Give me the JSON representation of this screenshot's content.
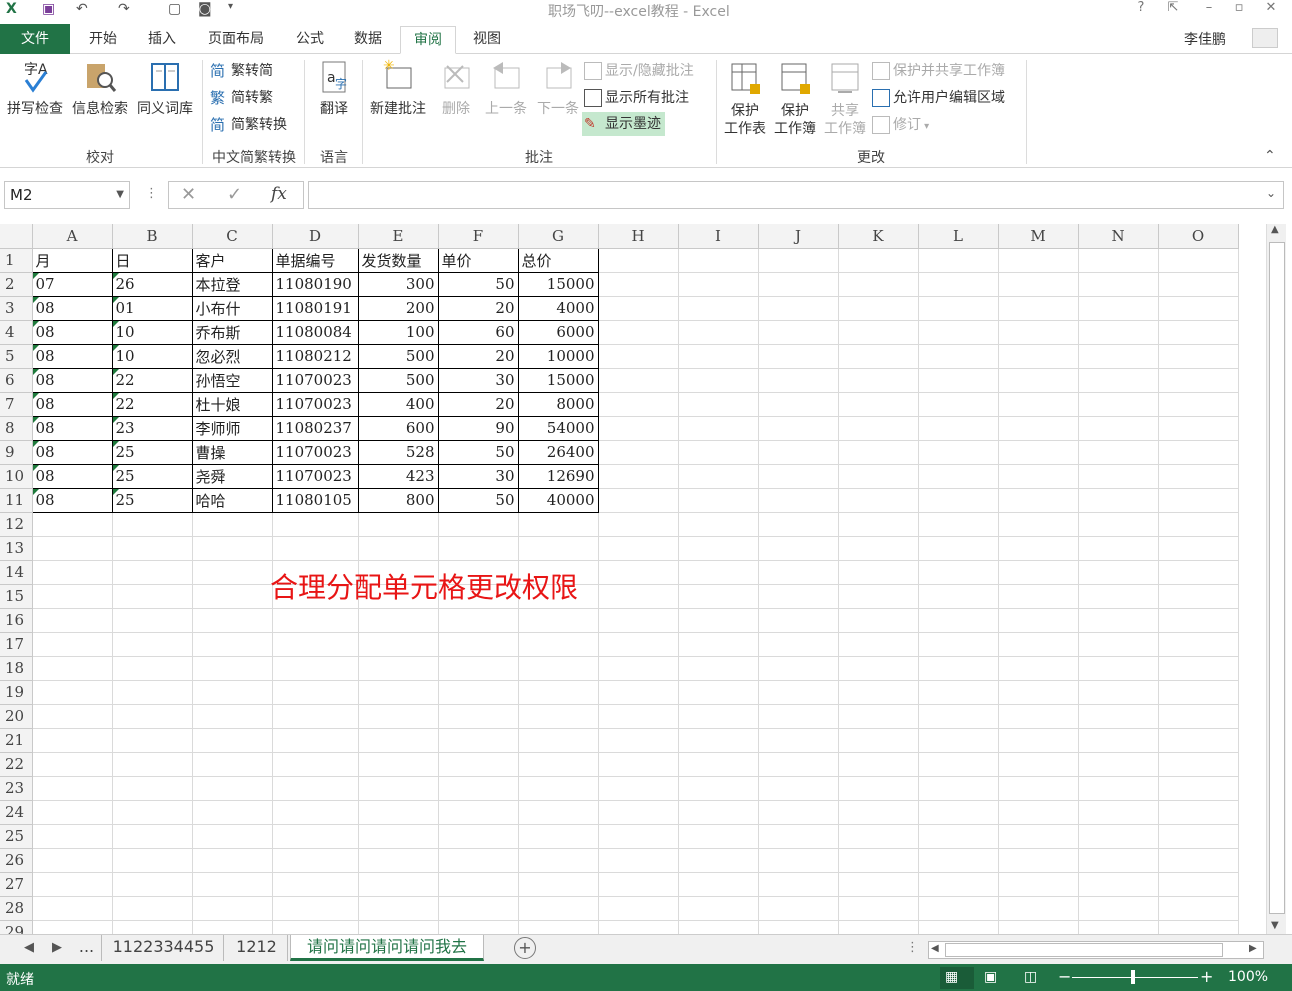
{
  "title_bar": {
    "app_title": "职场飞叨--excel教程 - Excel",
    "help": "?"
  },
  "tabs": {
    "file": "文件",
    "home": "开始",
    "insert": "插入",
    "layout": "页面布局",
    "formulas": "公式",
    "data": "数据",
    "review": "审阅",
    "view": "视图"
  },
  "user": {
    "name": "李佳鹏"
  },
  "ribbon": {
    "spell": "拼写检查",
    "research": "信息检索",
    "thesaurus": "同义词库",
    "proofing_group": "校对",
    "trad_to_simp": "繁转简",
    "simp_to_trad": "简转繁",
    "convert": "简繁转换",
    "chinese_group": "中文简繁转换",
    "translate": "翻译",
    "language_group": "语言",
    "new_comment": "新建批注",
    "delete": "删除",
    "prev": "上一条",
    "next": "下一条",
    "show_hide": "显示/隐藏批注",
    "show_all": "显示所有批注",
    "show_ink": "显示墨迹",
    "comments_group": "批注",
    "protect_sheet_1": "保护",
    "protect_sheet_2": "工作表",
    "protect_wb_1": "保护",
    "protect_wb_2": "工作簿",
    "share_1": "共享",
    "share_2": "工作簿",
    "protect_share": "保护并共享工作簿",
    "allow_edit": "允许用户编辑区域",
    "track": "修订",
    "changes_group": "更改"
  },
  "formula_bar": {
    "name_box": "M2",
    "formula": ""
  },
  "columns": [
    "A",
    "B",
    "C",
    "D",
    "E",
    "F",
    "G",
    "H",
    "I",
    "J",
    "K",
    "L",
    "M",
    "N",
    "O"
  ],
  "rows": [
    [
      "月",
      "日",
      "客户",
      "单据编号",
      "发货数量",
      "单价",
      "总价"
    ],
    [
      "07",
      "26",
      "本拉登",
      "11080190",
      "300",
      "50",
      "15000"
    ],
    [
      "08",
      "01",
      "小布什",
      "11080191",
      "200",
      "20",
      "4000"
    ],
    [
      "08",
      "10",
      "乔布斯",
      "11080084",
      "100",
      "60",
      "6000"
    ],
    [
      "08",
      "10",
      "忽必烈",
      "11080212",
      "500",
      "20",
      "10000"
    ],
    [
      "08",
      "22",
      "孙悟空",
      "11070023",
      "500",
      "30",
      "15000"
    ],
    [
      "08",
      "22",
      "杜十娘",
      "11070023",
      "400",
      "20",
      "8000"
    ],
    [
      "08",
      "23",
      "李师师",
      "11080237",
      "600",
      "90",
      "54000"
    ],
    [
      "08",
      "25",
      "曹操",
      "11070023",
      "528",
      "50",
      "26400"
    ],
    [
      "08",
      "25",
      "尧舜",
      "11070023",
      "423",
      "30",
      "12690"
    ],
    [
      "08",
      "25",
      "哈哈",
      "11080105",
      "800",
      "50",
      "40000"
    ]
  ],
  "row_count": 29,
  "overlay_text": "合理分配单元格更改权限",
  "sheets": {
    "more": "...",
    "s1": "1122334455",
    "s2": "1212",
    "s3": "请问请问请问请问我去"
  },
  "status": {
    "ready": "就绪",
    "zoom": "100%"
  },
  "colors": {
    "accent": "#217346",
    "overlay": "#e81515"
  }
}
